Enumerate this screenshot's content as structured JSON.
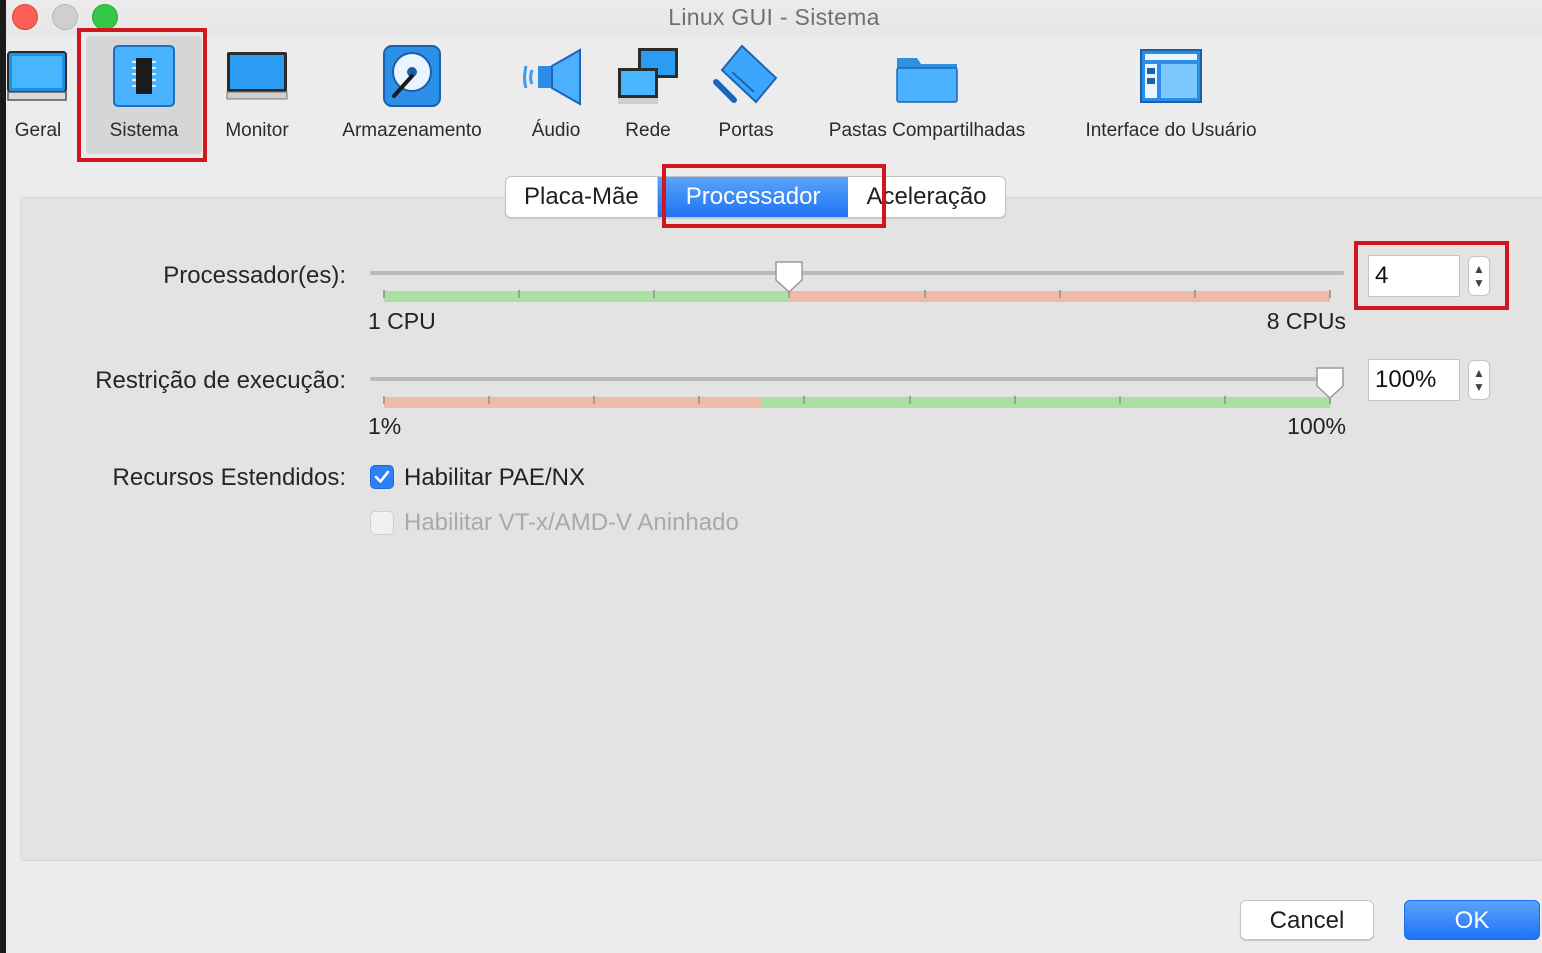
{
  "window": {
    "title": "Linux GUI - Sistema"
  },
  "toolbar": {
    "items": [
      {
        "label": "Geral",
        "icon": "monitor-general-icon"
      },
      {
        "label": "Sistema",
        "icon": "chip-icon",
        "selected": true
      },
      {
        "label": "Monitor",
        "icon": "display-icon"
      },
      {
        "label": "Armazenamento",
        "icon": "disk-icon"
      },
      {
        "label": "Áudio",
        "icon": "speaker-icon"
      },
      {
        "label": "Rede",
        "icon": "network-icon"
      },
      {
        "label": "Portas",
        "icon": "ports-icon"
      },
      {
        "label": "Pastas Compartilhadas",
        "icon": "folder-icon"
      },
      {
        "label": "Interface do Usuário",
        "icon": "window-ui-icon"
      }
    ]
  },
  "tabs": [
    {
      "label": "Placa-Mãe"
    },
    {
      "label": "Processador",
      "active": true
    },
    {
      "label": "Aceleração"
    }
  ],
  "processors": {
    "label": "Processador(es):",
    "value": "4",
    "min_label": "1 CPU",
    "max_label": "8 CPUs",
    "min": 1,
    "max": 8,
    "current": 4
  },
  "execution_cap": {
    "label": "Restrição de execução:",
    "value": "100%",
    "min_label": "1%",
    "max_label": "100%",
    "min": 1,
    "max": 100,
    "current": 100
  },
  "extended": {
    "label": "Recursos Estendidos:",
    "pae": {
      "label": "Habilitar PAE/NX",
      "checked": true
    },
    "vtx": {
      "label": "Habilitar VT-x/AMD-V Aninhado",
      "checked": false,
      "disabled": true
    }
  },
  "buttons": {
    "cancel": "Cancel",
    "ok": "OK"
  },
  "colors": {
    "accent": "#1f74f4",
    "highlight_box": "#d0171f",
    "slider_good": "#a9e1a1",
    "slider_bad": "#efbba8"
  }
}
